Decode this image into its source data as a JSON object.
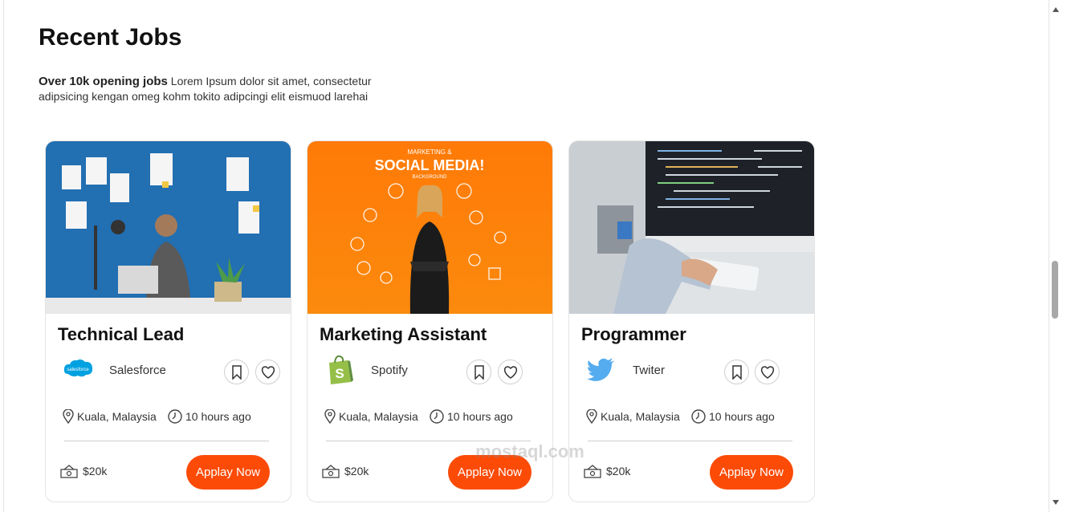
{
  "section": {
    "title": "Recent Jobs",
    "intro_bold": "Over 10k opening jobs",
    "intro_text": "Lorem Ipsum dolor sit amet, consectetur adipsicing kengan omeg kohm tokito adipcingi elit eismuod larehai"
  },
  "jobs": [
    {
      "title": "Technical Lead",
      "company": "Salesforce",
      "logo": "salesforce-logo",
      "location": "Kuala, Malaysia",
      "posted": "10 hours ago",
      "salary": "$20k",
      "apply_label": "Applay Now"
    },
    {
      "title": "Marketing Assistant",
      "company": "Spotify",
      "logo": "shopify-bag-logo",
      "location": "Kuala, Malaysia",
      "posted": "10 hours ago",
      "salary": "$20k",
      "apply_label": "Applay Now",
      "image_text": {
        "line1": "MARKETING &",
        "line2": "SOCIAL MEDIA!",
        "line3": "BACKGROUND"
      }
    },
    {
      "title": "Programmer",
      "company": "Twiter",
      "logo": "twitter-bird-logo",
      "location": "Kuala, Malaysia",
      "posted": "10 hours ago",
      "salary": "$20k",
      "apply_label": "Applay Now"
    }
  ],
  "watermark": "mostaql.com",
  "colors": {
    "accent": "#fb4b07",
    "salesforce": "#00a1e0",
    "shopify": "#95bf47",
    "twitter": "#1da1f2"
  }
}
